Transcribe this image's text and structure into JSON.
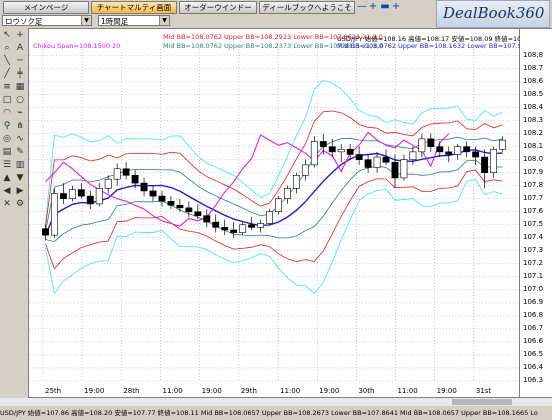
{
  "tabs": [
    {
      "label": "メインページ",
      "active": false
    },
    {
      "label": "チャートマルティ画面",
      "active": true
    },
    {
      "label": "オーダーウインドー",
      "active": false
    },
    {
      "label": "ディールブックへようこそ",
      "active": false
    }
  ],
  "toolbar_glyphs": [
    "—",
    "+",
    "▬",
    "+"
  ],
  "logo": "DealBook360",
  "symbol_select": "ロウソク足",
  "timeframe_select": "1時間足",
  "info_lines": {
    "bb_outer": "Mid BB=108.0762 Upper BB=108.2923 Lower BB=107.8621  21,2,0",
    "chikou": "Chikou Span=108.1500  20",
    "bb_inner": "Mid BB=108.0762 Upper BB=108.2373 Lower BB=107.9815  21,3,0",
    "quote": "USD/JPY 始値=108.16 高値=108.17 安値=108.09 終値=108.15",
    "bb_third": "Mid BB=108.0762 Upper BB=108.1632 Lower BB=107.9892  21,1,0"
  },
  "y_labels": [
    "108.8",
    "108.7",
    "108.6",
    "108.5",
    "108.4",
    "108.3",
    "108.2",
    "108.1",
    "108.0",
    "107.9",
    "107.8",
    "107.7",
    "107.6",
    "107.5",
    "107.4",
    "107.3",
    "107.2",
    "107.1",
    "107.0",
    "106.9",
    "106.8",
    "106.7",
    "106.6",
    "106.5",
    "106.4",
    "106.3"
  ],
  "x_labels": [
    "25th",
    "19:00",
    "28th",
    "11:00",
    "19:00",
    "29th",
    "11:00",
    "19:00",
    "30th",
    "11:00",
    "19:00",
    "31st"
  ],
  "status": "USD/JPY 始値=107.86 高値=108.20 安値=107.77 終値=108.11 Mid BB=108.0657 Upper BB=108.2673 Lower BB=107.8641 Mid BB=108.0657 Upper BB=108.1665 Lo",
  "colors": {
    "candle_up": "#ffffff",
    "candle_down": "#000000",
    "mid": "#1f1fd0",
    "bb1": "#2f7f7f",
    "bb2": "#e02020",
    "bb3": "#50e8f0",
    "chikou": "#e020e0"
  },
  "chart_data": {
    "type": "candlestick",
    "ylim": [
      106.3,
      108.85
    ],
    "candles": [
      [
        107.47,
        107.5,
        107.38,
        107.42
      ],
      [
        107.42,
        107.78,
        107.4,
        107.74
      ],
      [
        107.74,
        107.82,
        107.66,
        107.7
      ],
      [
        107.7,
        107.8,
        107.68,
        107.77
      ],
      [
        107.77,
        107.82,
        107.7,
        107.72
      ],
      [
        107.72,
        107.76,
        107.62,
        107.66
      ],
      [
        107.66,
        107.82,
        107.64,
        107.78
      ],
      [
        107.78,
        107.88,
        107.74,
        107.85
      ],
      [
        107.85,
        107.97,
        107.8,
        107.93
      ],
      [
        107.93,
        107.98,
        107.85,
        107.88
      ],
      [
        107.88,
        107.92,
        107.78,
        107.82
      ],
      [
        107.82,
        107.86,
        107.72,
        107.76
      ],
      [
        107.76,
        107.8,
        107.68,
        107.72
      ],
      [
        107.72,
        107.76,
        107.64,
        107.68
      ],
      [
        107.68,
        107.72,
        107.62,
        107.65
      ],
      [
        107.65,
        107.7,
        107.6,
        107.63
      ],
      [
        107.63,
        107.68,
        107.56,
        107.6
      ],
      [
        107.6,
        107.66,
        107.54,
        107.57
      ],
      [
        107.57,
        107.62,
        107.48,
        107.52
      ],
      [
        107.52,
        107.58,
        107.44,
        107.48
      ],
      [
        107.48,
        107.54,
        107.42,
        107.46
      ],
      [
        107.46,
        107.52,
        107.4,
        107.44
      ],
      [
        107.44,
        107.52,
        107.42,
        107.5
      ],
      [
        107.5,
        107.56,
        107.46,
        107.48
      ],
      [
        107.48,
        107.54,
        107.44,
        107.51
      ],
      [
        107.51,
        107.62,
        107.5,
        107.6
      ],
      [
        107.6,
        107.72,
        107.58,
        107.7
      ],
      [
        107.7,
        107.8,
        107.66,
        107.78
      ],
      [
        107.78,
        107.9,
        107.74,
        107.88
      ],
      [
        107.88,
        108.0,
        107.84,
        107.96
      ],
      [
        107.96,
        108.18,
        107.94,
        108.14
      ],
      [
        108.14,
        108.2,
        108.04,
        108.1
      ],
      [
        108.1,
        108.16,
        108.02,
        108.06
      ],
      [
        108.06,
        108.12,
        107.98,
        108.08
      ],
      [
        108.08,
        108.12,
        108.0,
        108.04
      ],
      [
        108.04,
        108.1,
        107.96,
        108.0
      ],
      [
        108.0,
        108.04,
        107.9,
        107.94
      ],
      [
        107.94,
        108.06,
        107.9,
        108.02
      ],
      [
        108.02,
        108.08,
        107.96,
        107.98
      ],
      [
        107.98,
        108.04,
        107.78,
        107.86
      ],
      [
        107.86,
        108.04,
        107.84,
        108.0
      ],
      [
        108.0,
        108.1,
        107.96,
        108.06
      ],
      [
        108.06,
        108.2,
        108.02,
        108.16
      ],
      [
        108.16,
        108.2,
        108.06,
        108.1
      ],
      [
        108.1,
        108.14,
        108.02,
        108.06
      ],
      [
        108.06,
        108.1,
        107.98,
        108.04
      ],
      [
        108.04,
        108.12,
        108.0,
        108.1
      ],
      [
        108.1,
        108.14,
        108.02,
        108.06
      ],
      [
        108.06,
        108.1,
        107.96,
        108.02
      ],
      [
        108.02,
        108.08,
        107.78,
        107.9
      ],
      [
        107.9,
        108.1,
        107.86,
        108.08
      ],
      [
        108.08,
        108.18,
        108.06,
        108.15
      ]
    ]
  }
}
